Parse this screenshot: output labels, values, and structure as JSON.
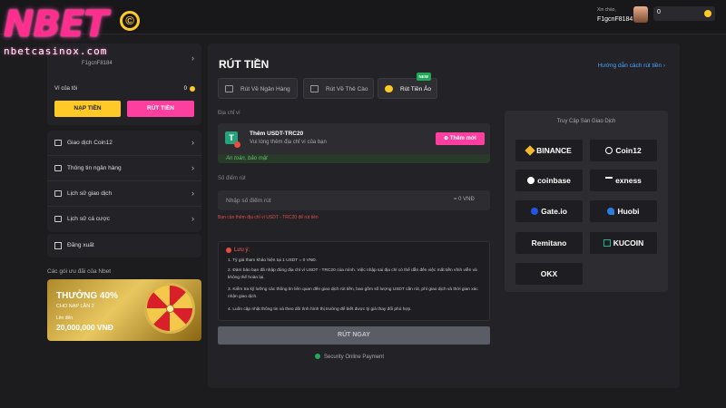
{
  "brand": {
    "name": "NBET",
    "domain": "nbetcasinox.com",
    "copyright": "©"
  },
  "header": {
    "greeting": "Xin chào,",
    "username": "F1gcnF8184",
    "balance": "0"
  },
  "sidebar": {
    "user_id": "F1gcnF8184",
    "wallet_label": "Ví của tôi",
    "wallet_value": "0",
    "deposit_label": "NẠP TIỀN",
    "withdraw_label": "RÚT TIỀN",
    "items": [
      {
        "label": "Giao dịch Coin12"
      },
      {
        "label": "Thông tin ngân hàng"
      },
      {
        "label": "Lịch sử giao dịch"
      },
      {
        "label": "Lịch sử cá cược"
      }
    ],
    "logout_label": "Đăng xuất",
    "promo_heading": "Các gói ưu đãi của Nbet",
    "promo": {
      "title": "THƯỞNG 40%",
      "subtitle": "CHO NẠP LẦN 2",
      "upto": "Lên đến",
      "amount": "20,000,000 VNĐ"
    }
  },
  "main": {
    "title": "RÚT TIỀN",
    "guide_link": "Hướng dẫn cách rút tiền ›",
    "tabs": [
      {
        "label": "Rút Về Ngân Hàng"
      },
      {
        "label": "Rút Về Thẻ Cào"
      },
      {
        "label": "Rút Tiền Ảo",
        "badge": "NEW"
      }
    ],
    "wallet_address_label": "Địa chỉ ví",
    "wallet_box_title": "Thêm USDT-TRC20",
    "wallet_box_sub": "Vui lòng thêm địa chỉ ví của bạn",
    "add_button": "Thêm mới",
    "safe_text": "An toàn, bảo mật",
    "amount_label": "Số điểm rút",
    "amount_placeholder": "Nhập số điểm rút",
    "amount_vnd": "= 0 VNĐ",
    "warning": "Bạn cần thêm địa chỉ ví USDT - TRC20 để rút tiền",
    "notes_title": "Lưu ý:",
    "notes": [
      "1. Tỷ giá tham khảo hiện tại 1 USDT = 0 VNĐ.",
      "2. Đảm bảo bạn đã nhập đúng địa chỉ ví USDT - TRC20 của mình. Việc nhập sai địa chỉ có thể dẫn đến việc mất tiền vĩnh viễn và không thể hoàn lại.",
      "3. Kiểm tra kỹ lưỡng các thông tin liên quan đến giao dịch rút tiền, bao gồm số lượng USDT cần rút, phí giao dịch và thời gian xác nhận giao dịch.",
      "4. Luôn cập nhật thông tin và theo dõi tình hình thị trường để biết được tỷ giá thay đổi phù hợp."
    ],
    "submit_label": "RÚT NGAY",
    "secure_text": "Security Online Payment"
  },
  "exchange": {
    "heading": "Truy Cập Sàn Giao Dịch",
    "items": [
      "BINANCE",
      "Coin12",
      "coinbase",
      "exness",
      "Gate.io",
      "Huobi",
      "Remitano",
      "KUCOIN",
      "OKX"
    ]
  }
}
